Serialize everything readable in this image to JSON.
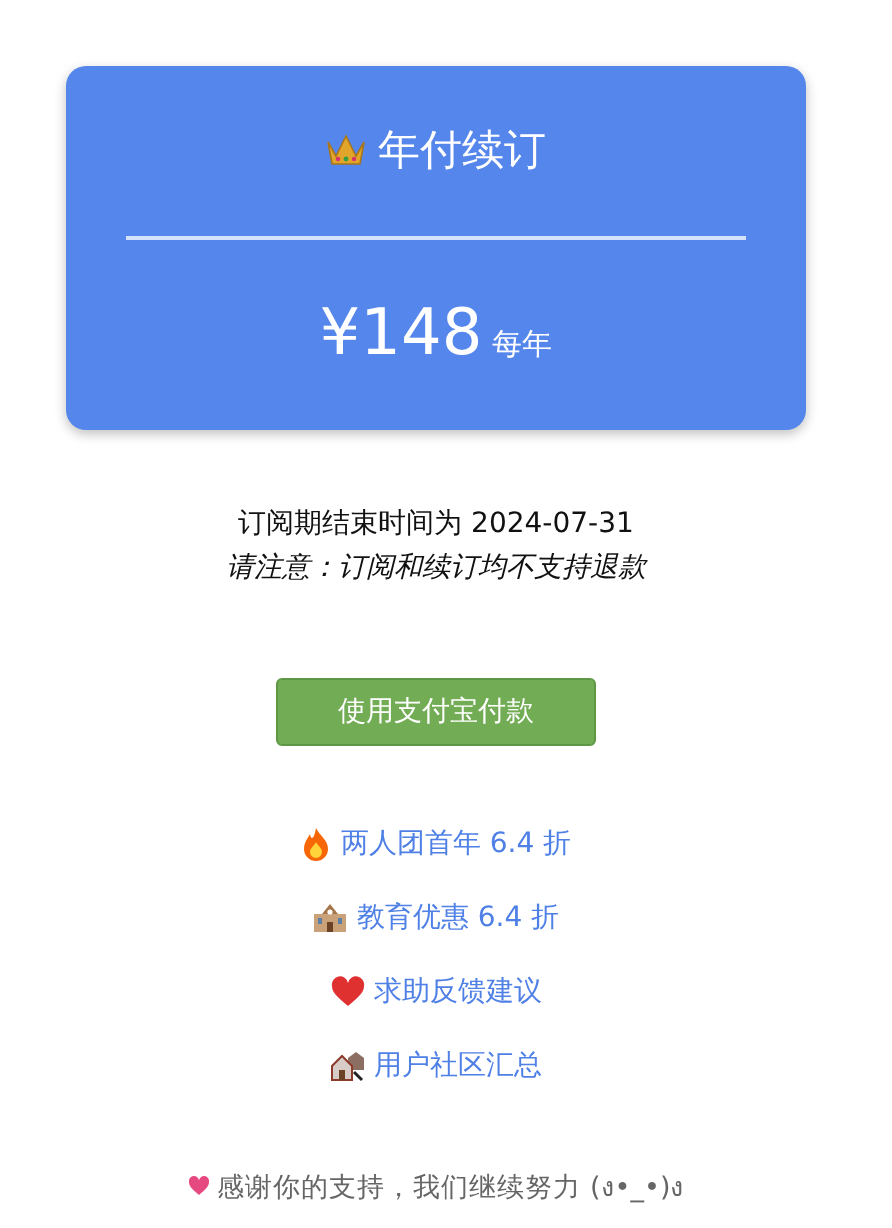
{
  "plan": {
    "title": "年付续订",
    "price": "¥148",
    "period": "每年"
  },
  "expiry": "订阅期结束时间为 2024-07-31",
  "notice": "请注意：订阅和续订均不支持退款",
  "pay_button": "使用支付宝付款",
  "links": [
    {
      "kind": "fire",
      "label": "两人团首年 6.4 折"
    },
    {
      "kind": "school",
      "label": "教育优惠 6.4 折"
    },
    {
      "kind": "heart",
      "label": "求助反馈建议"
    },
    {
      "kind": "houses",
      "label": "用户社区汇总"
    }
  ],
  "footer": "感谢你的支持，我们继续努力 (ง•_•)ง"
}
